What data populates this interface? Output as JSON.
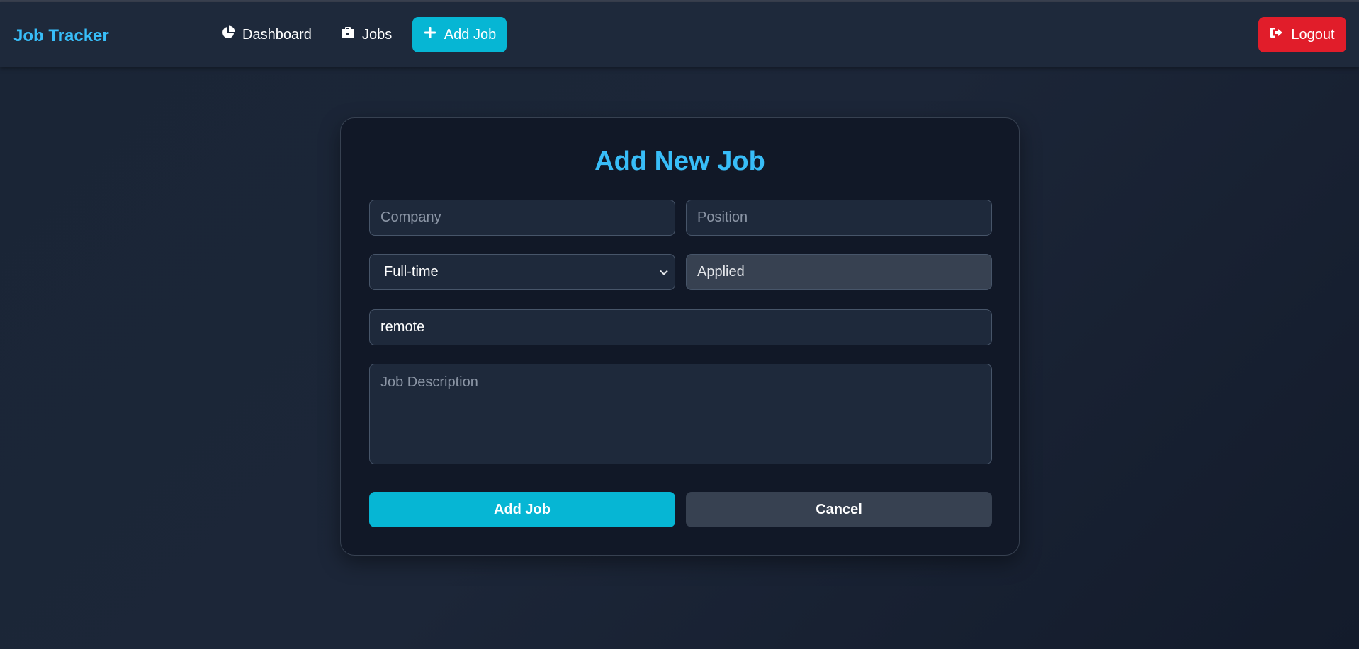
{
  "nav": {
    "brand": "Job Tracker",
    "links": [
      {
        "label": "Dashboard",
        "icon": "chart-pie-icon"
      },
      {
        "label": "Jobs",
        "icon": "briefcase-icon"
      },
      {
        "label": "Add Job",
        "icon": "plus-icon",
        "active": true
      }
    ],
    "logout_label": "Logout",
    "logout_icon": "sign-out-icon"
  },
  "form": {
    "title": "Add New Job",
    "company_placeholder": "Company",
    "position_placeholder": "Position",
    "job_type_value": "Full-time",
    "status_value": "Applied",
    "location_value": "remote",
    "description_placeholder": "Job Description",
    "submit_label": "Add Job",
    "cancel_label": "Cancel"
  },
  "colors": {
    "accent": "#38bdf8",
    "primary_button": "#06b6d4",
    "logout": "#e11d2a",
    "background": "#1c2638",
    "card": "#111827"
  }
}
